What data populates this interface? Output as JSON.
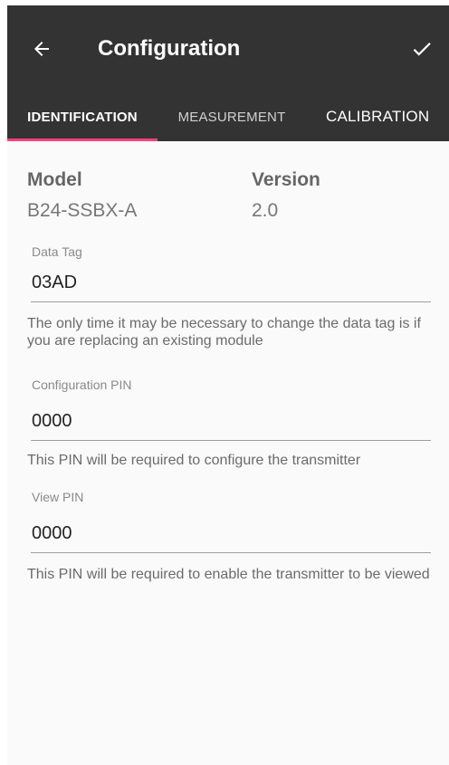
{
  "app_bar": {
    "title": "Configuration",
    "back_icon": "arrow-left-icon",
    "confirm_icon": "check-icon",
    "background_color": "#333333",
    "accent_color": "#ff4081"
  },
  "tabs": [
    {
      "label": "IDENTIFICATION",
      "active": true
    },
    {
      "label": "MEASUREMENT",
      "active": false
    },
    {
      "label": "CALIBRATION",
      "active": false
    }
  ],
  "identification": {
    "model_label": "Model",
    "model_value": "B24-SSBX-A",
    "version_label": "Version",
    "version_value": "2.0",
    "data_tag": {
      "label": "Data Tag",
      "value": "03AD",
      "help": "The only time it may be necessary to change the data tag is if you are replacing an existing module"
    },
    "config_pin": {
      "label": "Configuration PIN",
      "value": "0000",
      "help": "This PIN will be required to configure the transmitter"
    },
    "view_pin": {
      "label": "View PIN",
      "value": "0000",
      "help": "This PIN will be required to enable the transmitter to be viewed"
    }
  }
}
